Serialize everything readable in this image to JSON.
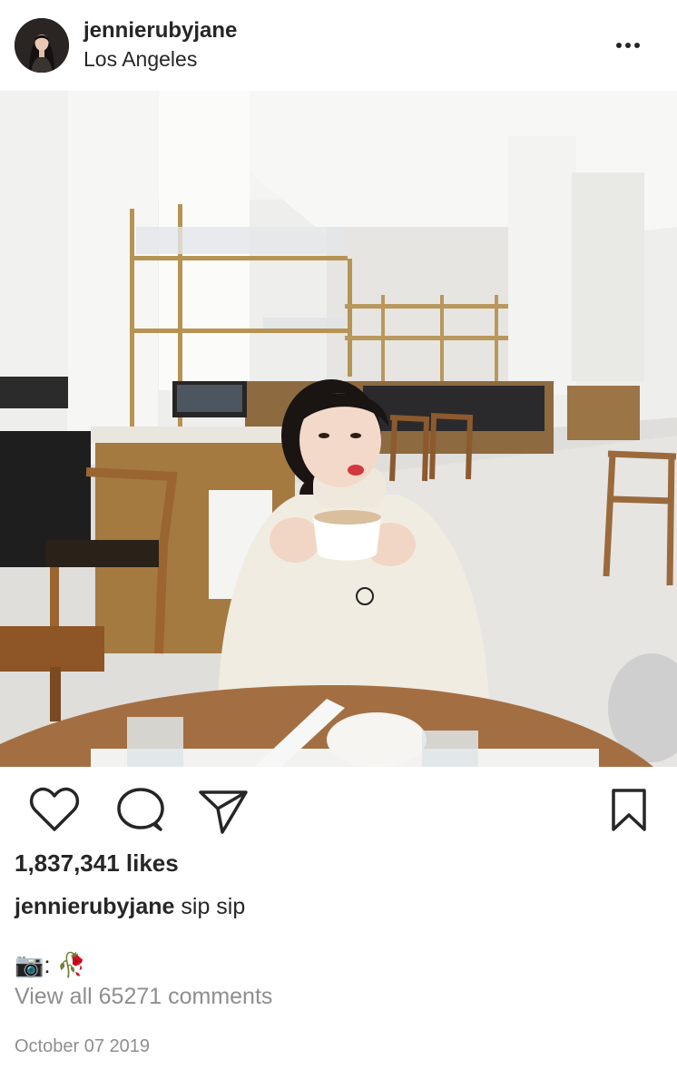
{
  "post": {
    "username": "jennierubyjane",
    "location": "Los Angeles",
    "likes": "1,837,341 likes",
    "caption_user": "jennierubyjane",
    "caption_text": " sip sip",
    "caption_line2_sep": ": ",
    "camera_emoji": "📷",
    "rose_emoji": "🥀",
    "comments_link": "View all 65271 comments",
    "date": "October 07 2019"
  },
  "icons": {
    "more": "more-options-icon",
    "like": "heart-icon",
    "comment": "comment-bubble-icon",
    "share": "paper-plane-icon",
    "save": "bookmark-icon"
  },
  "colors": {
    "text": "#262626",
    "muted": "#8e8e8e",
    "background": "#ffffff"
  }
}
